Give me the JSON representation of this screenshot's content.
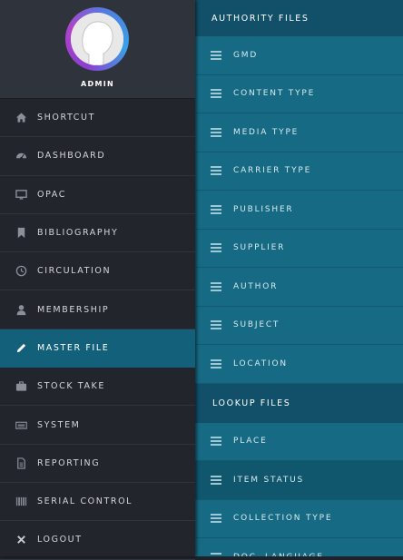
{
  "profile": {
    "name": "ADMIN"
  },
  "menu": [
    {
      "label": "SHORTCUT",
      "icon": "home-icon",
      "active": false
    },
    {
      "label": "DASHBOARD",
      "icon": "dashboard-icon",
      "active": false
    },
    {
      "label": "OPAC",
      "icon": "monitor-icon",
      "active": false
    },
    {
      "label": "BIBLIOGRAPHY",
      "icon": "bookmark-icon",
      "active": false
    },
    {
      "label": "CIRCULATION",
      "icon": "clock-icon",
      "active": false
    },
    {
      "label": "MEMBERSHIP",
      "icon": "user-icon",
      "active": false
    },
    {
      "label": "MASTER FILE",
      "icon": "pencil-icon",
      "active": true
    },
    {
      "label": "STOCK TAKE",
      "icon": "briefcase-icon",
      "active": false
    },
    {
      "label": "SYSTEM",
      "icon": "keyboard-icon",
      "active": false
    },
    {
      "label": "REPORTING",
      "icon": "file-icon",
      "active": false
    },
    {
      "label": "SERIAL CONTROL",
      "icon": "barcode-icon",
      "active": false
    },
    {
      "label": "LOGOUT",
      "icon": "close-icon",
      "active": false
    }
  ],
  "submenu": {
    "authority_header": "AUTHORITY FILES",
    "authority_items": [
      "GMD",
      "CONTENT TYPE",
      "MEDIA TYPE",
      "CARRIER TYPE",
      "PUBLISHER",
      "SUPPLIER",
      "AUTHOR",
      "SUBJECT",
      "LOCATION"
    ],
    "lookup_header": "LOOKUP FILES",
    "lookup_items": [
      "PLACE",
      "ITEM STATUS",
      "COLLECTION TYPE",
      "DOC. LANGUAGE"
    ],
    "highlighted_item": "ITEM STATUS"
  },
  "colors": {
    "sidebar_bg": "#22252c",
    "active_bg": "#12607a",
    "submenu_bg": "#166a84",
    "section_header_bg": "#115068"
  }
}
